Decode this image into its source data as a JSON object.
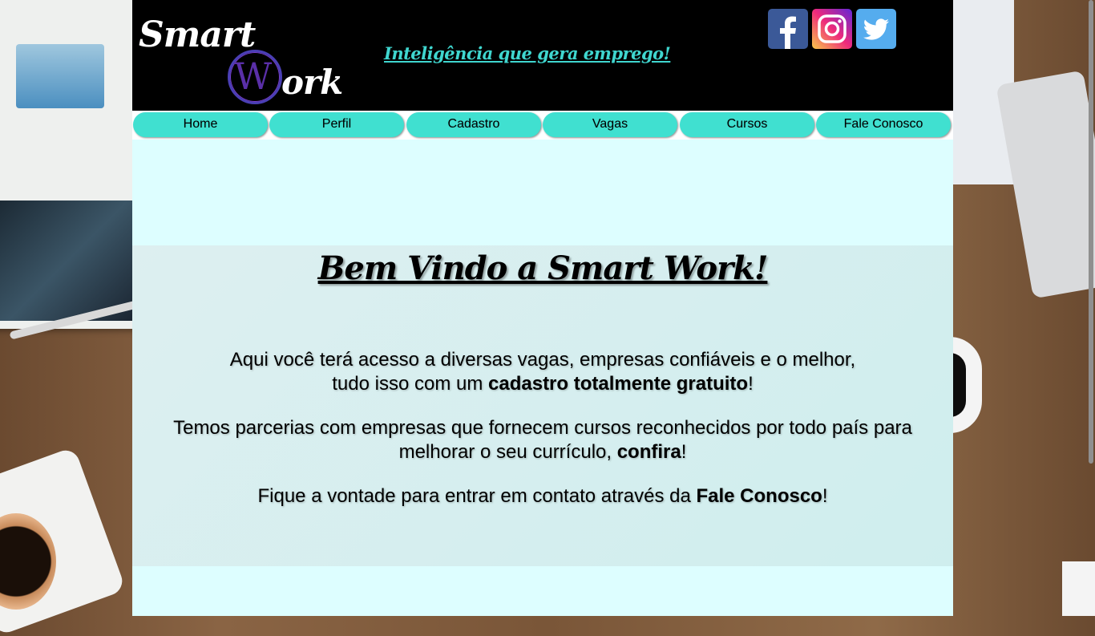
{
  "header": {
    "logo_smart": "Smart",
    "logo_w": "W",
    "logo_ork": "ork",
    "tagline": "Inteligência que gera emprego!",
    "social": [
      {
        "name": "facebook",
        "icon": "facebook-icon"
      },
      {
        "name": "instagram",
        "icon": "instagram-icon"
      },
      {
        "name": "twitter",
        "icon": "twitter-icon"
      }
    ]
  },
  "nav": {
    "items": [
      {
        "label": "Home"
      },
      {
        "label": "Perfil"
      },
      {
        "label": "Cadastro"
      },
      {
        "label": "Vagas"
      },
      {
        "label": "Cursos"
      },
      {
        "label": "Fale Conosco"
      }
    ]
  },
  "hero": {
    "title": "Bem Vindo a Smart Work!",
    "p1_line1": "Aqui você terá acesso a diversas vagas, empresas confiáveis e o melhor,",
    "p1_line2_pre": "tudo isso com um ",
    "p1_line2_bold": "cadastro totalmente gratuito",
    "p1_line2_post": "!",
    "p2_line1": "Temos parcerias com empresas que fornecem cursos reconhecidos por todo país para",
    "p2_line2_pre": "melhorar o seu currículo, ",
    "p2_line2_bold": "confira",
    "p2_line2_post": "!",
    "p3_pre": "Fique a vontade para entrar em contato através da ",
    "p3_bold": "Fale Conosco",
    "p3_post": "!"
  },
  "colors": {
    "header_bg": "#000000",
    "accent": "#40e0d0",
    "tagline": "#3fd6cf",
    "page_bg": "#ddfeff"
  }
}
